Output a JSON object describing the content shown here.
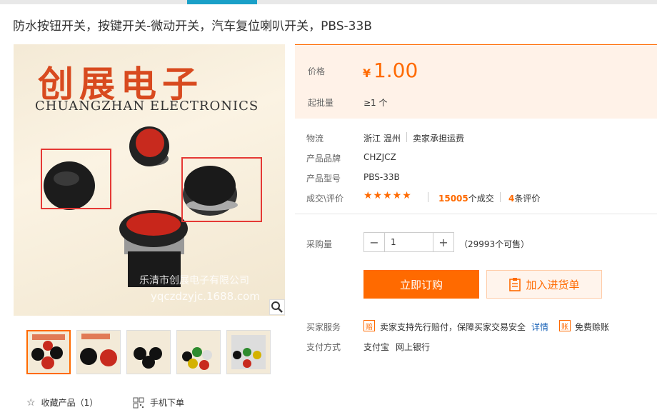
{
  "title": "防水按钮开关，按键开关-微动开关，汽车复位喇叭开关，PBS-33B",
  "image": {
    "brand_cn": "创展电子",
    "brand_en": "CHUANGZHAN ELECTRONICS",
    "watermark_cn": "乐清市创展电子有限公司",
    "watermark_url": "yqczdzyjc.1688.com"
  },
  "actions": {
    "favorite": "收藏产品（1）",
    "mobile_order": "手机下单"
  },
  "price": {
    "label": "价格",
    "currency": "¥",
    "value": "1.00"
  },
  "min_order": {
    "label": "起批量",
    "value": "≥1 个"
  },
  "logistics": {
    "label": "物流",
    "location": "浙江 温州",
    "shipping": "卖家承担运费"
  },
  "brand": {
    "label": "产品品牌",
    "value": "CHZJCZ"
  },
  "model": {
    "label": "产品型号",
    "value": "PBS-33B"
  },
  "deals": {
    "label": "成交\\评价",
    "stars": "★★★★★",
    "deal_count": "15005",
    "deal_suffix": "个成交",
    "review_count": "4",
    "review_suffix": "条评价"
  },
  "quantity": {
    "label": "采购量",
    "minus": "−",
    "value": "1",
    "plus": "+",
    "stock": "（29993个可售）"
  },
  "buttons": {
    "buy": "立即订购",
    "cart": "加入进货单"
  },
  "service": {
    "label": "买家服务",
    "icon1": "赔",
    "text1": "卖家支持先行赔付，保障买家交易安全",
    "detail": "详情",
    "icon2": "账",
    "text2": "免费赊账"
  },
  "payment": {
    "label": "支付方式",
    "method1": "支付宝",
    "method2": "网上银行"
  },
  "colors": {
    "accent": "#ff6a00",
    "link": "#1a63b8"
  }
}
